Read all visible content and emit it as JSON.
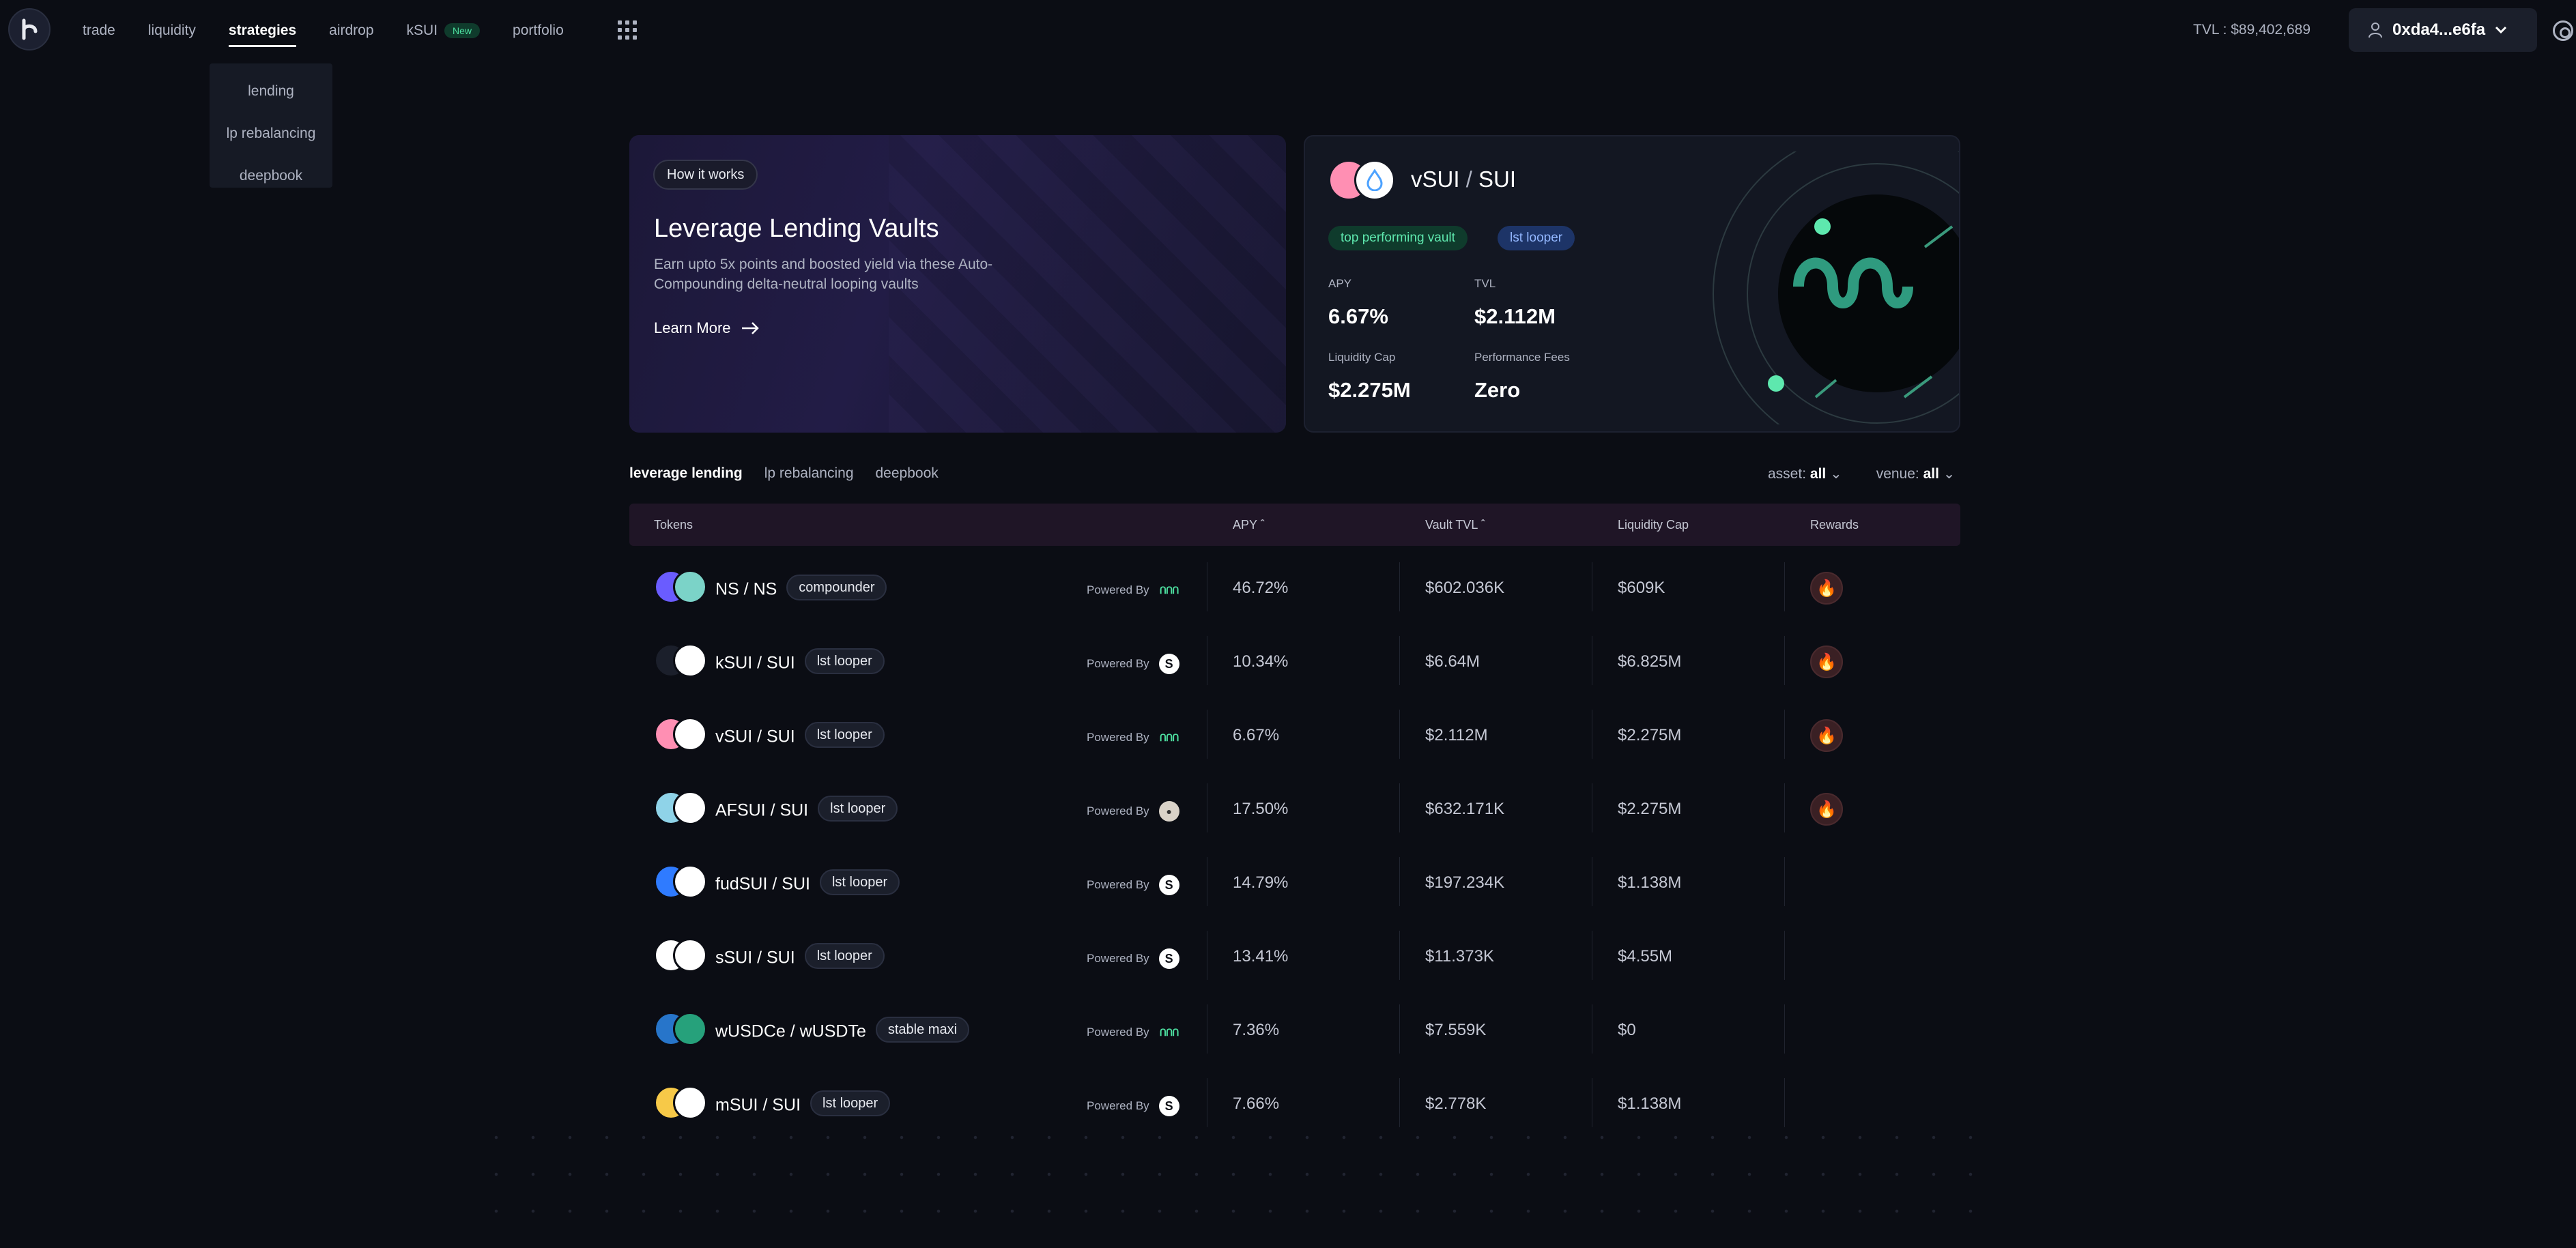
{
  "nav": {
    "links": [
      {
        "label": "trade"
      },
      {
        "label": "liquidity"
      },
      {
        "label": "strategies"
      },
      {
        "label": "airdrop"
      },
      {
        "label": "kSUI",
        "badge": "New"
      },
      {
        "label": "portfolio"
      }
    ],
    "tvl_label": "TVL : $89,402,689",
    "wallet": "0xda4...e6fa"
  },
  "dropdown": {
    "items": [
      "lending",
      "lp rebalancing",
      "deepbook"
    ]
  },
  "hero": {
    "badge": "How it works",
    "title": "Leverage Lending Vaults",
    "description": "Earn upto 5x points and boosted yield via these Auto-Compounding delta-neutral looping vaults",
    "cta": "Learn More"
  },
  "vault": {
    "base": "vSUI",
    "quote": "SUI",
    "tag1": "top performing vault",
    "tag2": "lst looper",
    "apy_label": "APY",
    "apy": "6.67%",
    "tvl_label": "TVL",
    "tvl": "$2.112M",
    "cap_label": "Liquidity Cap",
    "cap": "$2.275M",
    "fees_label": "Performance Fees",
    "fees": "Zero"
  },
  "tabs": [
    "leverage lending",
    "lp rebalancing",
    "deepbook"
  ],
  "filters": {
    "asset_label": "asset:",
    "asset_value": "all",
    "venue_label": "venue:",
    "venue_value": "all"
  },
  "table": {
    "headers": {
      "tokens": "Tokens",
      "apy": "APY",
      "tvl": "Vault TVL",
      "cap": "Liquidity Cap",
      "rewards": "Rewards"
    },
    "powered_label": "Powered By",
    "rows": [
      {
        "pair": "NS / NS",
        "tag": "compounder",
        "power": "navi",
        "apy": "46.72%",
        "tvl": "$602.036K",
        "cap": "$609K",
        "reward": true,
        "c1": "#6a5cff",
        "c2": "#7bd3c8"
      },
      {
        "pair": "kSUI / SUI",
        "tag": "lst looper",
        "power": "sui",
        "apy": "10.34%",
        "tvl": "$6.64M",
        "cap": "$6.825M",
        "reward": true,
        "c1": "#1b1f2b",
        "c2": "#ffffff"
      },
      {
        "pair": "vSUI / SUI",
        "tag": "lst looper",
        "power": "navi",
        "apy": "6.67%",
        "tvl": "$2.112M",
        "cap": "$2.275M",
        "reward": true,
        "c1": "#ff8fb3",
        "c2": "#ffffff"
      },
      {
        "pair": "AFSUI / SUI",
        "tag": "lst looper",
        "power": "af",
        "apy": "17.50%",
        "tvl": "$632.171K",
        "cap": "$2.275M",
        "reward": true,
        "c1": "#8fd3e8",
        "c2": "#ffffff"
      },
      {
        "pair": "fudSUI / SUI",
        "tag": "lst looper",
        "power": "sui",
        "apy": "14.79%",
        "tvl": "$197.234K",
        "cap": "$1.138M",
        "reward": false,
        "c1": "#2f7bff",
        "c2": "#ffffff"
      },
      {
        "pair": "sSUI / SUI",
        "tag": "lst looper",
        "power": "sui",
        "apy": "13.41%",
        "tvl": "$11.373K",
        "cap": "$4.55M",
        "reward": false,
        "c1": "#ffffff",
        "c2": "#ffffff"
      },
      {
        "pair": "wUSDCe / wUSDTe",
        "tag": "stable maxi",
        "power": "navi",
        "apy": "7.36%",
        "tvl": "$7.559K",
        "cap": "$0",
        "reward": false,
        "c1": "#2775ca",
        "c2": "#26a17b"
      },
      {
        "pair": "mSUI / SUI",
        "tag": "lst looper",
        "power": "sui",
        "apy": "7.66%",
        "tvl": "$2.778K",
        "cap": "$1.138M",
        "reward": false,
        "c1": "#f7c948",
        "c2": "#ffffff"
      }
    ]
  },
  "colors": {
    "accent": "#5ee8ae",
    "fire": "#ff5a4a",
    "header_bg": "#1f1526"
  }
}
